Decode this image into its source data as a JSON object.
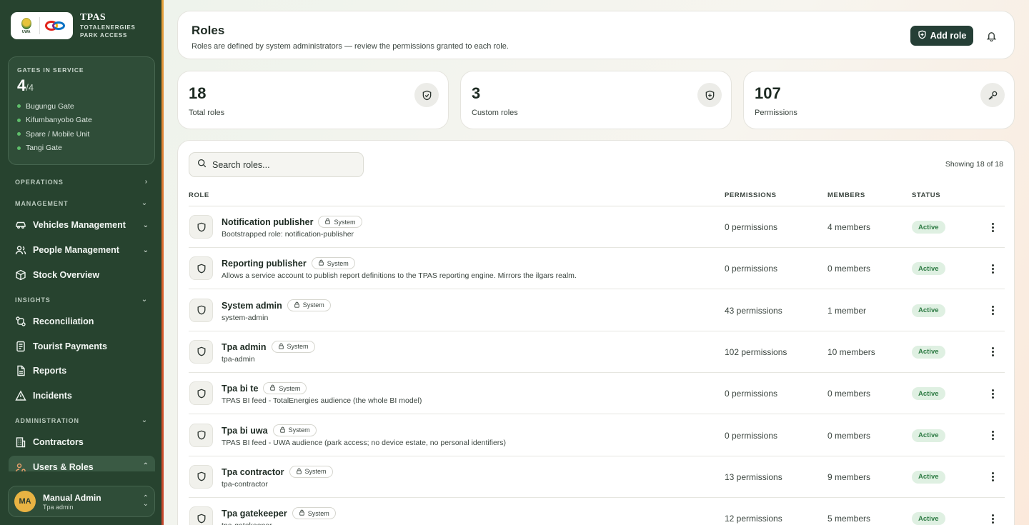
{
  "brand": {
    "title": "TPAS",
    "subtitle_line1": "TOTALENERGIES",
    "subtitle_line2": "PARK ACCESS",
    "uwa_text": "UWA"
  },
  "gates": {
    "label": "GATES IN SERVICE",
    "count": "4",
    "total": "/4",
    "items": [
      {
        "name": "Bugungu Gate"
      },
      {
        "name": "Kifumbanyobo Gate"
      },
      {
        "name": "Spare / Mobile Unit"
      },
      {
        "name": "Tangi Gate"
      }
    ]
  },
  "nav": {
    "sections": {
      "operations": "OPERATIONS",
      "management": "MANAGEMENT",
      "insights": "INSIGHTS",
      "administration": "ADMINISTRATION"
    },
    "items": {
      "vehicles": "Vehicles Management",
      "people": "People Management",
      "stock": "Stock Overview",
      "reconciliation": "Reconciliation",
      "tourist_payments": "Tourist Payments",
      "reports": "Reports",
      "incidents": "Incidents",
      "contractors": "Contractors",
      "users_roles": "Users & Roles"
    }
  },
  "user": {
    "initials": "MA",
    "name": "Manual Admin",
    "role": "Tpa admin"
  },
  "header": {
    "title": "Roles",
    "subtitle": "Roles are defined by system administrators — review the permissions granted to each role.",
    "add_button": "Add role"
  },
  "stats": [
    {
      "value": "18",
      "label": "Total roles",
      "icon": "shield-check-icon"
    },
    {
      "value": "3",
      "label": "Custom roles",
      "icon": "shield-plus-icon"
    },
    {
      "value": "107",
      "label": "Permissions",
      "icon": "key-icon"
    }
  ],
  "table": {
    "search_placeholder": "Search roles...",
    "showing": "Showing 18 of 18",
    "columns": {
      "role": "ROLE",
      "permissions": "PERMISSIONS",
      "members": "MEMBERS",
      "status": "STATUS"
    },
    "rows": [
      {
        "name": "Notification publisher",
        "badge": "System",
        "desc": "Bootstrapped role: notification-publisher",
        "permissions": "0 permissions",
        "members": "4 members",
        "status": "Active"
      },
      {
        "name": "Reporting publisher",
        "badge": "System",
        "desc": "Allows a service account to publish report definitions to the TPAS reporting engine. Mirrors the ilgars realm.",
        "permissions": "0 permissions",
        "members": "0 members",
        "status": "Active"
      },
      {
        "name": "System admin",
        "badge": "System",
        "desc": "system-admin",
        "permissions": "43 permissions",
        "members": "1 member",
        "status": "Active"
      },
      {
        "name": "Tpa admin",
        "badge": "System",
        "desc": "tpa-admin",
        "permissions": "102 permissions",
        "members": "10 members",
        "status": "Active"
      },
      {
        "name": "Tpa bi te",
        "badge": "System",
        "desc": "TPAS BI feed - TotalEnergies audience (the whole BI model)",
        "permissions": "0 permissions",
        "members": "0 members",
        "status": "Active"
      },
      {
        "name": "Tpa bi uwa",
        "badge": "System",
        "desc": "TPAS BI feed - UWA audience (park access; no device estate, no personal identifiers)",
        "permissions": "0 permissions",
        "members": "0 members",
        "status": "Active"
      },
      {
        "name": "Tpa contractor",
        "badge": "System",
        "desc": "tpa-contractor",
        "permissions": "13 permissions",
        "members": "9 members",
        "status": "Active"
      },
      {
        "name": "Tpa gatekeeper",
        "badge": "System",
        "desc": "tpa-gatekeeper",
        "permissions": "12 permissions",
        "members": "5 members",
        "status": "Active"
      }
    ]
  }
}
